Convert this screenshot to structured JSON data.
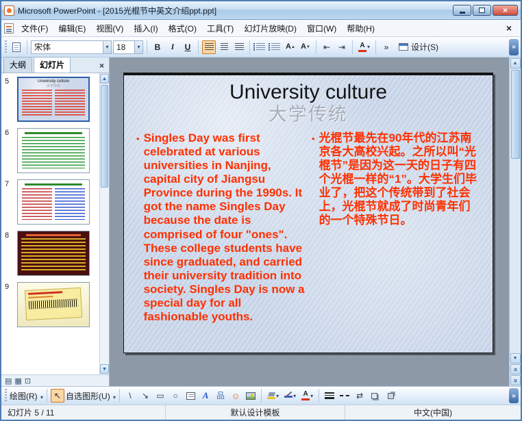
{
  "window": {
    "title": "Microsoft PowerPoint - [2015光棍节中英文介绍ppt.ppt]",
    "close_glyph": "×"
  },
  "menubar": {
    "items": [
      "文件(F)",
      "编辑(E)",
      "视图(V)",
      "插入(I)",
      "格式(O)",
      "工具(T)",
      "幻灯片放映(D)",
      "窗口(W)",
      "帮助(H)"
    ],
    "close_glyph": "×"
  },
  "toolbar": {
    "font_name": "宋体",
    "font_size": "18",
    "bold": "B",
    "italic": "I",
    "underline": "U",
    "font_letter": "A",
    "design_label": "设计(S)"
  },
  "left_pane": {
    "tabs": [
      "大纲",
      "幻灯片"
    ],
    "close_glyph": "×",
    "thumb_numbers": [
      "5",
      "6",
      "7",
      "8",
      "9"
    ]
  },
  "slide": {
    "title_en": "University culture",
    "title_zh": "大学传统",
    "bullet_en": "Singles Day was first celebrated at various universities in Nanjing, capital city of Jiangsu Province during the 1990s. It got the name Singles Day because the date is comprised of four \"ones\". These college students have since graduated, and carried their university tradition into society. Singles Day is now a special day for all fashionable youths.",
    "bullet_zh": "光棍节最先在90年代的江苏南京各大高校兴起。之所以叫“光棍节”是因为这一天的日子有四个光棍一样的“1”。大学生们毕业了，把这个传统带到了社会上，光棍节就成了时尚青年们的一个特殊节日。"
  },
  "drawing_toolbar": {
    "draw_label": "绘图(R)",
    "autoshapes_label": "自选图形(U)"
  },
  "statusbar": {
    "slide_info": "幻灯片 5 / 11",
    "template_name": "默认设计模板",
    "language": "中文(中国)"
  },
  "icons": {
    "dropdown": "▾",
    "scroll_up": "▲",
    "scroll_down": "▼",
    "scroll_left": "◀",
    "prev_slide": "«",
    "next_slide": "»",
    "overflow": "»",
    "bullet": "•",
    "pointer": "↖",
    "line": "\\",
    "arrow": "↘",
    "rect": "▭",
    "oval": "○",
    "wordart": "A",
    "diagram": "品",
    "clipart": "☺",
    "arrow_style": "⇄",
    "font_up": "▲",
    "font_down": "▼",
    "indent_left": "⇤",
    "indent_right": "⇥",
    "normal_view": "▤",
    "sorter_view": "▦",
    "slideshow_view": "⊡"
  },
  "colors": {
    "body_text_red": "#ff3000",
    "titlebar_blue": "#a9cae8",
    "close_button_red": "#d04b3c",
    "selection_blue": "#2a5fa8"
  }
}
